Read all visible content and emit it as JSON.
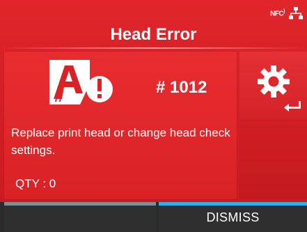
{
  "status_bar": {
    "icons": [
      "nfc-icon",
      "network-icon"
    ],
    "nfc_label": "NFC"
  },
  "title": "Head Error",
  "error": {
    "icon": "print-head-warning-icon",
    "code": "# 1012",
    "message": "Replace print head or change head check settings.",
    "qty": "QTY : 0"
  },
  "settings_button": {
    "icons": [
      "gear-icon",
      "enter-arrow-icon"
    ]
  },
  "bottom_bar": {
    "left_softkey_label": "",
    "dismiss_label": "DISMISS"
  },
  "colors": {
    "background_red": "#d41f25",
    "panel_red": "#e82d30",
    "bottom_bar": "#2f2f2f",
    "left_indicator": "#7f8f99",
    "dismiss_indicator": "#2fb0e8"
  }
}
